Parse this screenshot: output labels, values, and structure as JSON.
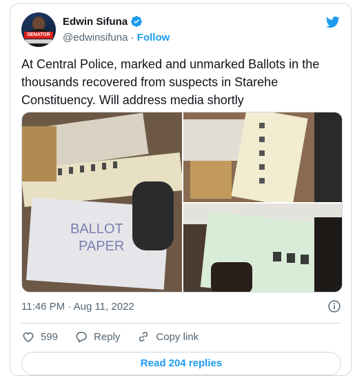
{
  "user": {
    "name": "Edwin Sifuna",
    "handle": "@edwinsifuna",
    "follow_label": "Follow",
    "avatar_badge": "SENATOR"
  },
  "tweet": {
    "text": "At Central Police, marked and unmarked Ballots in the thousands recovered from suspects in Starehe Constituency. Will address media shortly",
    "timestamp": "11:46 PM · Aug 11, 2022"
  },
  "actions": {
    "likes": "599",
    "reply_label": "Reply",
    "copy_label": "Copy link"
  },
  "read_replies_label": "Read 204 replies",
  "colors": {
    "accent": "#1d9bf0",
    "muted": "#536471",
    "border": "#cfd9de"
  },
  "icons": [
    "verified-badge-icon",
    "twitter-bird-icon",
    "info-icon",
    "heart-icon",
    "reply-icon",
    "link-icon"
  ]
}
